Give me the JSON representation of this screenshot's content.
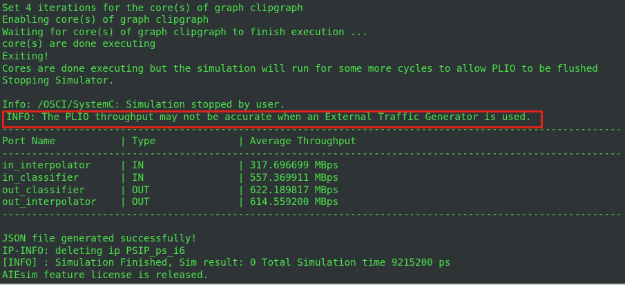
{
  "terminal": {
    "colors": {
      "background": "#2e3436",
      "text": "#4ce04c",
      "highlight_border": "#e2231a"
    },
    "lines": [
      "Set 4 iterations for the core(s) of graph clipgraph",
      "Enabling core(s) of graph clipgraph",
      "Waiting for core(s) of graph clipgraph to finish execution ...",
      "core(s) are done executing",
      "Exiting!",
      "Cores are done executing but the simulation will run for some more cycles to allow PLIO to be flushed",
      "Stopping Simulator.",
      "",
      "Info: /OSCI/SystemC: Simulation stopped by user.",
      "INFO: The PLIO throughput may not be accurate when an External Traffic Generator is used.",
      "----------------------------------------------------------------------------------------------------------",
      "Port Name           | Type              | Average Throughput",
      "----------------------------------------------------------------------------------------------------------",
      "in_interpolator     | IN                | 317.696699 MBps",
      "in_classifier       | IN                | 557.369911 MBps",
      "out_classifier      | OUT               | 622.189817 MBps",
      "out_interpolator    | OUT               | 614.559200 MBps",
      "----------------------------------------------------------------------------------------------------------",
      "",
      "JSON file generated successfully!",
      "IP-INFO: deleting ip PSIP_ps_i6",
      "[INFO] : Simulation Finished, Sim result: 0 Total Simulation time 9215200 ps",
      "AIEsim feature license is released."
    ]
  }
}
